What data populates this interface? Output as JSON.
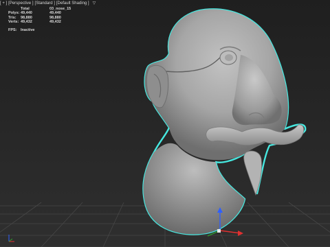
{
  "viewport": {
    "menu": [
      "[ + ]",
      "[Perspective ]",
      "[Standard ]",
      "[Default Shading ]"
    ],
    "filter_icon": "filter-icon",
    "view_name": "Perspective"
  },
  "stats": {
    "header": [
      "",
      "Total",
      "03_nose_15"
    ],
    "rows": [
      {
        "label": "Polys:",
        "total": "49,440",
        "selected": "49,440"
      },
      {
        "label": "Tris:",
        "total": "98,880",
        "selected": "98,880"
      },
      {
        "label": "Verts:",
        "total": "49,432",
        "selected": "49,432"
      }
    ],
    "fps_label": "FPS:",
    "fps_value": "Inactive"
  },
  "scene": {
    "object_name": "03_nose_15",
    "selection_outline_color": "#46e8e0",
    "mesh_color": "#a9a9a9",
    "gizmo": {
      "x_axis_color": "#e03030",
      "y_axis_color": "#2e9e2e",
      "z_axis_color": "#2f5fff"
    }
  },
  "colors": {
    "background_top": "#1f1f1f",
    "background_bottom": "#2f2f2f",
    "grid": "#4a4a4a",
    "text": "#d9d9d9"
  }
}
